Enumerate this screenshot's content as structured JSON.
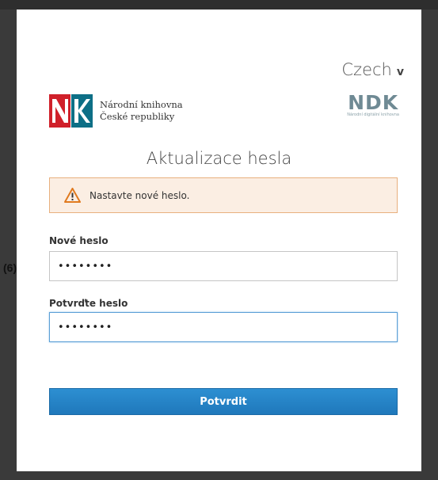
{
  "language": {
    "current": "Czech",
    "chevron": "v"
  },
  "logos": {
    "nk": {
      "line1": "Národní knihovna",
      "line2": "České republiky"
    },
    "ndk": {
      "mark": "NDK",
      "sub": "Národní digitální knihovna"
    }
  },
  "page": {
    "title": "Aktualizace hesla"
  },
  "alert": {
    "message": "Nastavte nové heslo.",
    "icon": "warning-icon",
    "color": "#fbeee3"
  },
  "form": {
    "new_password": {
      "label": "Nové heslo",
      "value": "••••••••"
    },
    "confirm_password": {
      "label": "Potvrďte heslo",
      "value": "••••••••"
    },
    "submit_label": "Potvrdit"
  },
  "annotation": {
    "step": "(6)"
  },
  "colors": {
    "accent": "#2a86c9",
    "nk_red": "#d0202a",
    "nk_teal": "#0d6f86"
  }
}
